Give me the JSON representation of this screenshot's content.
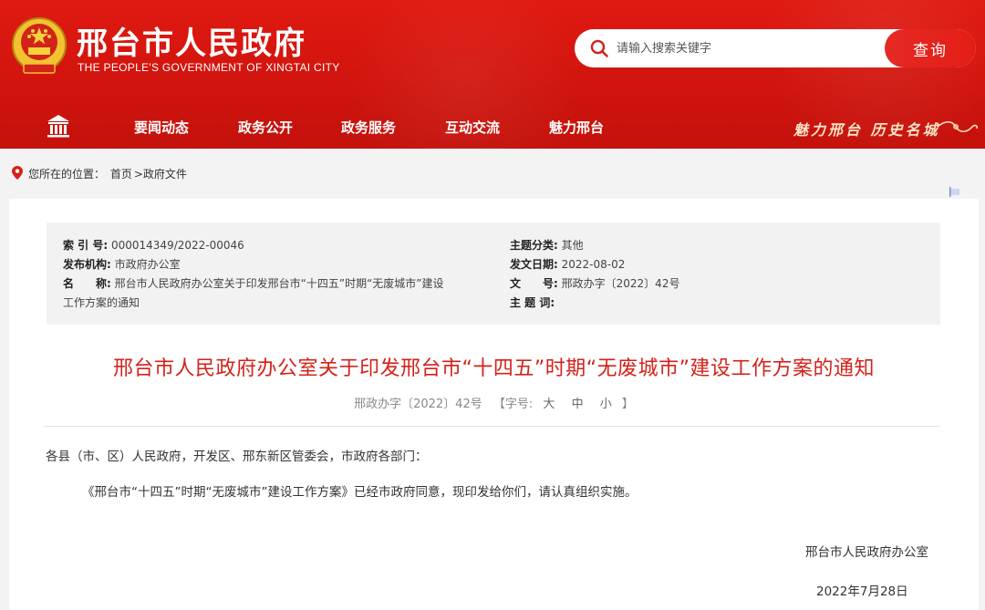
{
  "site": {
    "title": "邢台市人民政府",
    "subtitle": "THE PEOPLE'S GOVERNMENT OF XINGTAI CITY",
    "emblem_icon": "national-emblem-icon"
  },
  "search": {
    "placeholder": "请输入搜索关键字",
    "button_label": "查询"
  },
  "nav": {
    "items": [
      "要闻动态",
      "政务公开",
      "政务服务",
      "互动交流",
      "魅力邢台"
    ],
    "slogan": "魅力邢台 历史名城"
  },
  "breadcrumb": {
    "prefix": "您所在的位置：",
    "home": "首页",
    "separator": ">",
    "current": "政府文件"
  },
  "meta": {
    "index_label": "索 引 号:",
    "index_value": "000014349/2022-00046",
    "topic_label": "主题分类:",
    "topic_value": "其他",
    "org_label": "发布机构:",
    "org_value": "市政府办公室",
    "date_label": "发文日期:",
    "date_value": "2022-08-02",
    "name_label": "名　　称:",
    "name_value_line1": "邢台市人民政府办公室关于印发邢台市“十四五”时期“无废城市”建设",
    "name_value_line2": "工作方案的通知",
    "docno_label": "文　　号:",
    "docno_value": "邢政办字〔2022〕42号",
    "keyword_label": "主 题 词:",
    "keyword_value": ""
  },
  "document": {
    "title": "邢台市人民政府办公室关于印发邢台市“十四五”时期“无废城市”建设工作方案的通知",
    "doc_no": "邢政办字〔2022〕42号",
    "font_size_label": "【字号:",
    "font_sizes": [
      "大",
      "中",
      "小"
    ],
    "font_size_close": "】",
    "salutation": "各县（市、区）人民政府，开发区、邢东新区管委会，市政府各部门：",
    "body": "《邢台市“十四五”时期“无废城市”建设工作方案》已经市政府同意，现印发给你们，请认真组织实施。",
    "signer": "邢台市人民政府办公室",
    "date": "2022年7月28日"
  },
  "colors": {
    "header_red": "#d8170f",
    "title_red": "#d3221a",
    "slogan_gold": "#fbe3c4"
  }
}
